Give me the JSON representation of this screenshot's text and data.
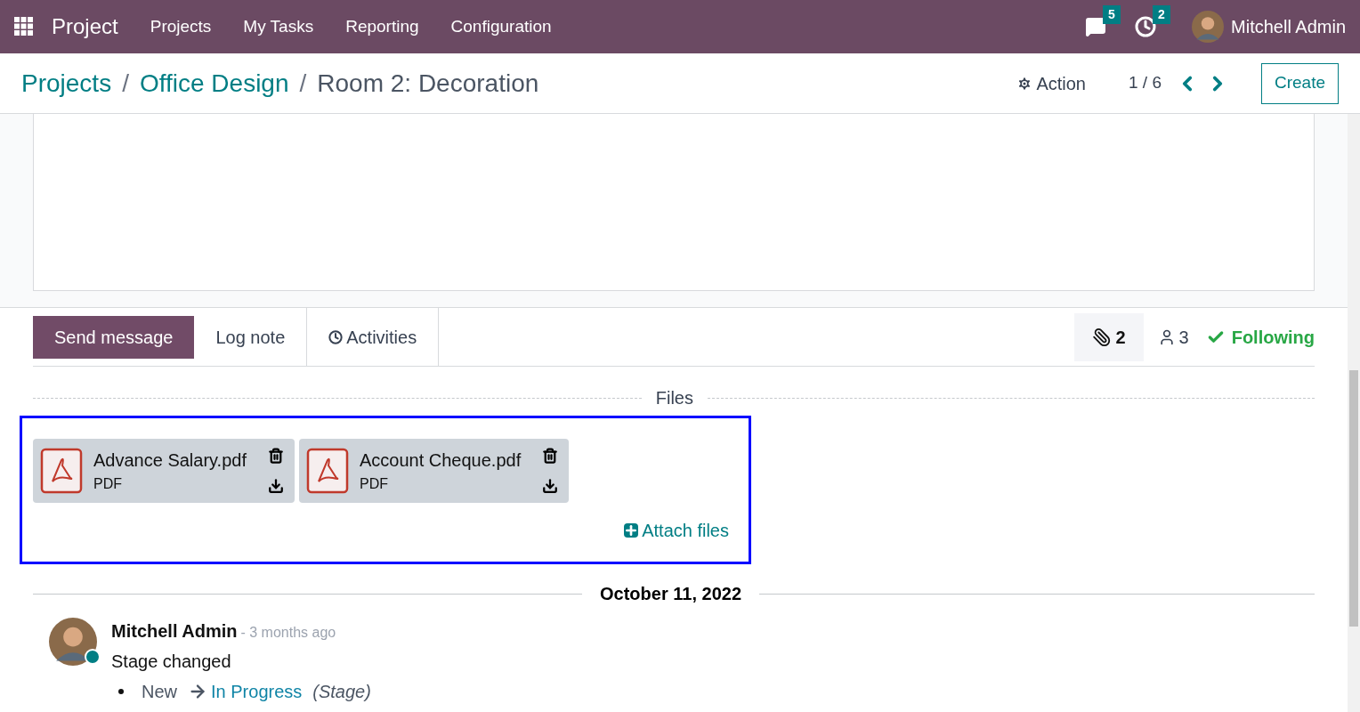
{
  "navbar": {
    "app_name": "Project",
    "menu": [
      "Projects",
      "My Tasks",
      "Reporting",
      "Configuration"
    ],
    "messages_count": "5",
    "activities_count": "2",
    "user": "Mitchell Admin"
  },
  "control_panel": {
    "breadcrumbs": [
      {
        "label": "Projects",
        "kind": "link"
      },
      {
        "label": "Office Design",
        "kind": "link"
      },
      {
        "label": "Room 2: Decoration",
        "kind": "current"
      }
    ],
    "separator": "/",
    "action": "Action",
    "pager": "1 / 6",
    "create": "Create"
  },
  "chatter": {
    "tabs": [
      {
        "label": "Send message",
        "selected": true,
        "kind": "plain"
      },
      {
        "label": "Log note",
        "selected": false,
        "kind": "plain"
      },
      {
        "label": "Activities",
        "selected": false,
        "kind": "activity"
      }
    ],
    "attachments_count": "2",
    "followers_count": "3",
    "following": "Following",
    "files_title": "Files",
    "files": [
      {
        "name": "Advance Salary.pdf",
        "type": "PDF"
      },
      {
        "name": "Account Cheque.pdf",
        "type": "PDF"
      }
    ],
    "attach": "Attach files",
    "date": "October 11, 2022",
    "messages": [
      {
        "author": "Mitchell Admin",
        "time": "- 3 months ago",
        "body": "Stage changed",
        "online": true,
        "old_value": "New",
        "new_value": "In Progress",
        "field": "(Stage)"
      }
    ]
  }
}
